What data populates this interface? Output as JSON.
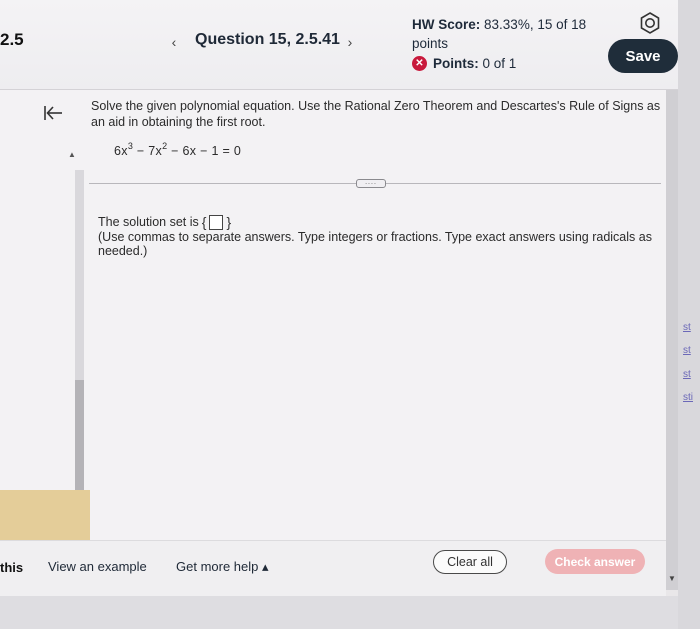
{
  "header": {
    "section_number": "2.5",
    "question_title": "Question 15, 2.5.41",
    "prev_icon": "chevron-left-icon",
    "next_icon": "chevron-right-icon",
    "hw_score_label": "HW Score:",
    "hw_score_value": "83.33%, 15 of 18",
    "hw_score_unit": "points",
    "points_label": "Points:",
    "points_value": "0 of 1",
    "save_label": "Save",
    "colors": {
      "save_bg": "#1f2d3a",
      "points_icon": "#c8193c"
    }
  },
  "question": {
    "prompt": "Solve the given polynomial equation. Use the Rational Zero Theorem and Descartes's Rule of Signs as an aid in obtaining the first root.",
    "equation": {
      "t1": "6x",
      "e1": "3",
      "t2": " − 7x",
      "e2": "2",
      "t3": " − 6x − 1 = 0"
    },
    "more_label": "....",
    "answer_prefix": "The solution set is",
    "brace_open": "{",
    "brace_close": "}",
    "instructions": "(Use commas to separate answers. Type integers or fractions. Type exact answers using radicals as needed.)"
  },
  "right_links": [
    "st",
    "st",
    "st",
    "sti"
  ],
  "footer": {
    "left_text": "this",
    "view_example": "View an example",
    "get_more_help": "Get more help ▴",
    "clear_all": "Clear all",
    "check_answer": "Check answer",
    "colors": {
      "check_bg": "#efb2b5"
    }
  }
}
